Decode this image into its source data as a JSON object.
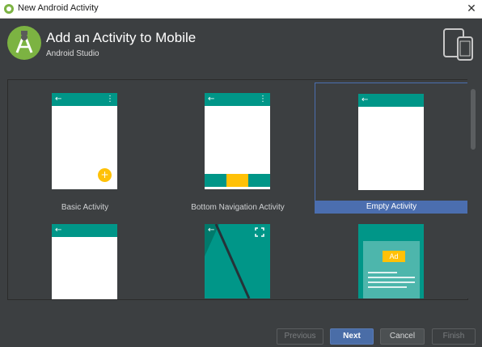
{
  "window": {
    "title": "New Android Activity",
    "close_glyph": "✕"
  },
  "header": {
    "title": "Add an Activity to Mobile",
    "subtitle": "Android Studio"
  },
  "gallery": {
    "tiles": [
      {
        "label": "Basic Activity",
        "selected": false,
        "fab_glyph": "+"
      },
      {
        "label": "Bottom Navigation Activity",
        "selected": false
      },
      {
        "label": "Empty Activity",
        "selected": true
      },
      {
        "label": "",
        "selected": false
      },
      {
        "label": "",
        "selected": false
      },
      {
        "label": "",
        "selected": false,
        "ad_text": "Ad"
      }
    ],
    "back_glyph": "←",
    "menu_glyph": "⋮"
  },
  "buttons": {
    "previous": "Previous",
    "next": "Next",
    "cancel": "Cancel",
    "finish": "Finish"
  },
  "colors": {
    "accent_teal": "#009688",
    "fab_yellow": "#ffc107",
    "selection_blue": "#4b6eaf",
    "background": "#3c3f41"
  }
}
